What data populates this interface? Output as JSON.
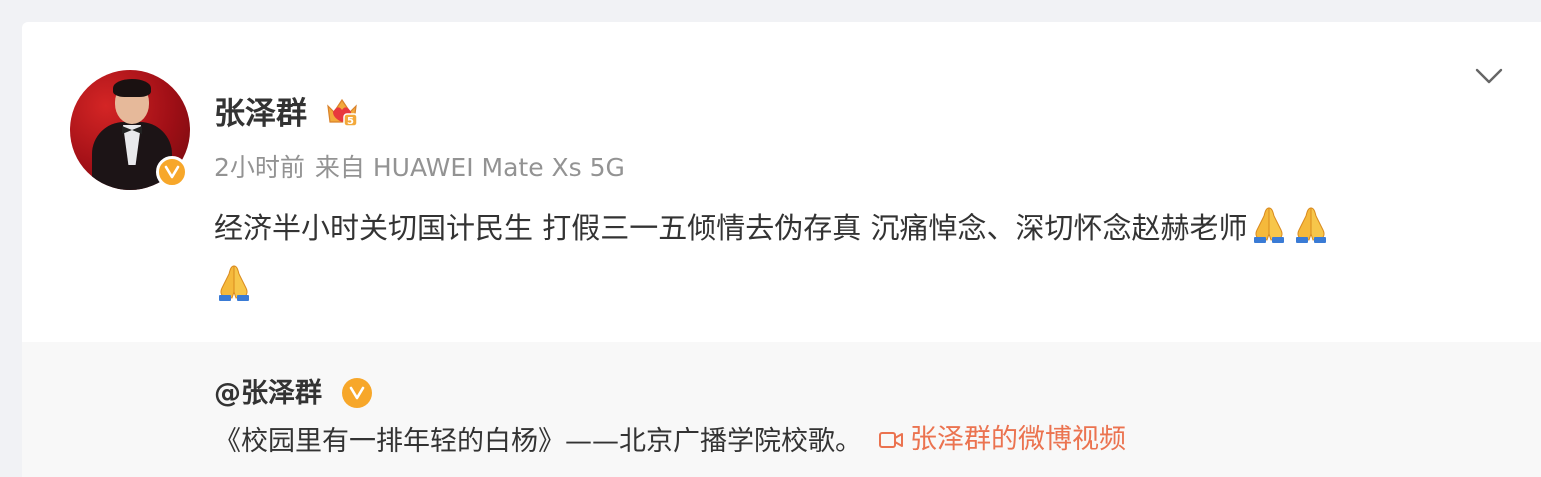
{
  "post": {
    "username": "张泽群",
    "time": "2小时前",
    "source": "来自 HUAWEI Mate Xs 5G",
    "text": "经济半小时关切国计民生 打假三一五倾情去伪存真 沉痛悼念、深切怀念赵赫老师",
    "emojis": [
      "🙏",
      "🙏",
      "🙏"
    ],
    "crown_level": "5"
  },
  "repost": {
    "author": "@张泽群",
    "text": "《校园里有一排年轻的白杨》——北京广播学院校歌。",
    "video_link": "张泽群的微博视频"
  },
  "icons": {
    "verified": "verified-v-icon",
    "crown": "crown-level-icon",
    "more": "chevron-down-icon",
    "video": "video-camera-icon",
    "emoji": "folded-hands-emoji"
  },
  "colors": {
    "accent_orange": "#eb7350",
    "verified_gold": "#f7a72a",
    "meta_gray": "#939393",
    "text": "#333333"
  }
}
